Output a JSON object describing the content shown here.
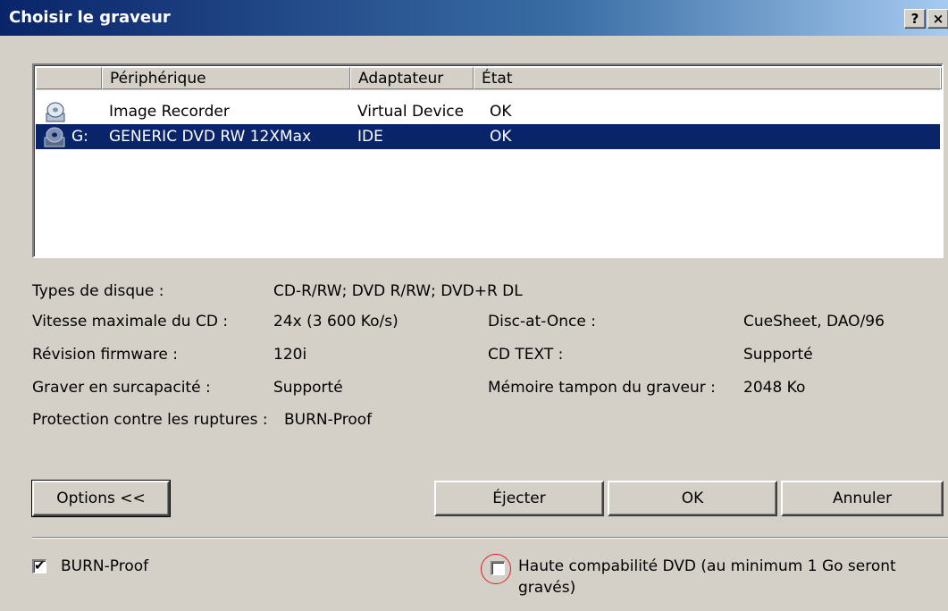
{
  "window": {
    "title": "Choisir le graveur",
    "help_label": "?",
    "close_label": "×"
  },
  "devices": {
    "columns": {
      "device": "Périphérique",
      "adapter": "Adaptateur",
      "state": "État"
    },
    "rows": [
      {
        "icon": "image-recorder-icon",
        "drive": "",
        "name": "Image Recorder",
        "adapter": "Virtual Device",
        "state": "OK",
        "selected": false
      },
      {
        "icon": "dvd-burner-icon",
        "drive": "G:",
        "name": "GENERIC DVD RW 12XMax",
        "adapter": "IDE",
        "state": "OK",
        "selected": true
      }
    ]
  },
  "info": {
    "disc_types": {
      "label": "Types de disque :",
      "value": "CD-R/RW; DVD R/RW; DVD+R DL"
    },
    "max_speed": {
      "label": "Vitesse maximale du CD :",
      "value": "24x (3 600 Ko/s)"
    },
    "firmware": {
      "label": "Révision firmware :",
      "value": "120i"
    },
    "overburn": {
      "label": "Graver en surcapacité :",
      "value": "Supporté"
    },
    "protection": {
      "label": "Protection contre les ruptures :",
      "value": "BURN-Proof"
    },
    "dao": {
      "label": "Disc-at-Once :",
      "value": "CueSheet, DAO/96"
    },
    "cd_text": {
      "label": "CD TEXT :",
      "value": "Supporté"
    },
    "buffer": {
      "label": "Mémoire tampon du graveur :",
      "value": "2048 Ko"
    }
  },
  "buttons": {
    "options": "Options <<",
    "eject": "Éjecter",
    "ok": "OK",
    "cancel": "Annuler"
  },
  "options": {
    "burn_proof": {
      "label": "BURN-Proof",
      "checked": true
    },
    "dvd_compat": {
      "label": "Haute compabilité DVD (au minimum 1 Go seront",
      "label2": "gravés)",
      "checked": false
    }
  },
  "colors": {
    "selection": "#0a246a",
    "annotation_circle": "#e02020"
  }
}
